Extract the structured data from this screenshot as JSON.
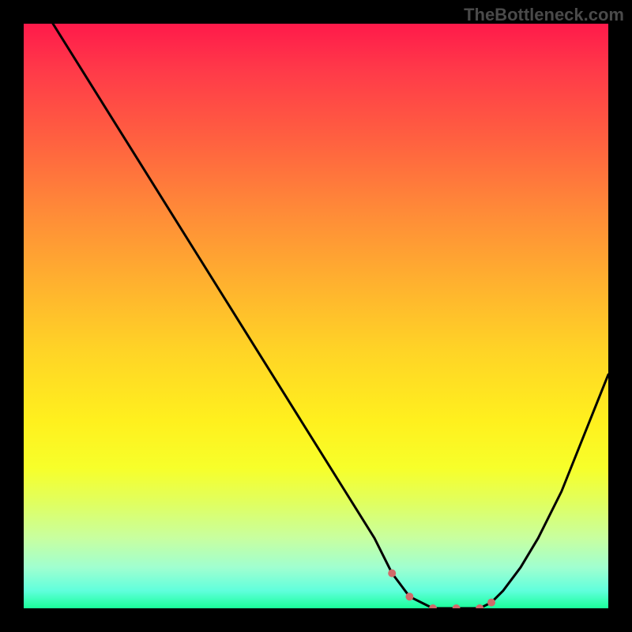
{
  "watermark": "TheBottleneck.com",
  "chart_data": {
    "type": "line",
    "title": "",
    "xlabel": "",
    "ylabel": "",
    "xlim": [
      0,
      100
    ],
    "ylim": [
      0,
      100
    ],
    "gradient_background": {
      "top": "#ff1a4a",
      "bottom": "#1aff9a",
      "meaning": "red (high bottleneck) to green (low bottleneck)"
    },
    "series": [
      {
        "name": "bottleneck-curve",
        "type": "line",
        "x": [
          5,
          10,
          15,
          20,
          25,
          30,
          35,
          40,
          45,
          50,
          55,
          60,
          63,
          66,
          70,
          74,
          78,
          80,
          82,
          85,
          88,
          92,
          96,
          100
        ],
        "y": [
          100,
          92,
          84,
          76,
          68,
          60,
          52,
          44,
          36,
          28,
          20,
          12,
          6,
          2,
          0,
          0,
          0,
          1,
          3,
          7,
          12,
          20,
          30,
          40
        ]
      },
      {
        "name": "optimal-markers",
        "type": "scatter",
        "x": [
          63,
          66,
          70,
          74,
          78,
          80
        ],
        "y": [
          6,
          2,
          0,
          0,
          0,
          1
        ],
        "color": "#d16a6a"
      }
    ],
    "annotations": []
  }
}
